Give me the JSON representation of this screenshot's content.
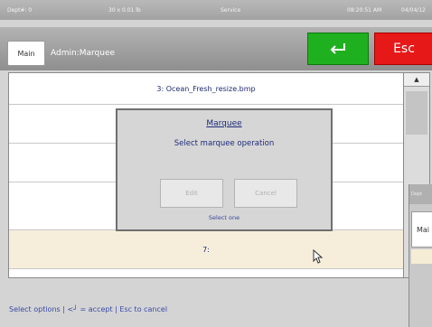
{
  "status": {
    "dept": "Dept#: 0",
    "weight": "30 x 0.01 lb",
    "mode": "Service",
    "time": "08:20:51 AM",
    "date": "04/04/12"
  },
  "header": {
    "main_label": "Main",
    "title": "Admin:Marquee",
    "esc_label": "Esc"
  },
  "list": {
    "rows": [
      {
        "label": "3: Ocean_Fresh_resize.bmp"
      },
      {
        "label": ""
      },
      {
        "label": ""
      },
      {
        "label": ""
      },
      {
        "label": "7:"
      }
    ],
    "scroll_up": "▲"
  },
  "dialog": {
    "title": "Marquee",
    "message": "Select marquee operation",
    "edit_label": "Edit",
    "cancel_label": "Cancel",
    "hint": "Select one"
  },
  "footer": {
    "hint": "Select options | <┘ = accept | Esc to cancel"
  },
  "second_window": {
    "dept": "Dept",
    "main_partial": "Mai"
  },
  "colors": {
    "enter": "#1fb01f",
    "esc": "#e61818",
    "highlight_row": "#f6eedb",
    "accent_text": "#1f2a72"
  }
}
